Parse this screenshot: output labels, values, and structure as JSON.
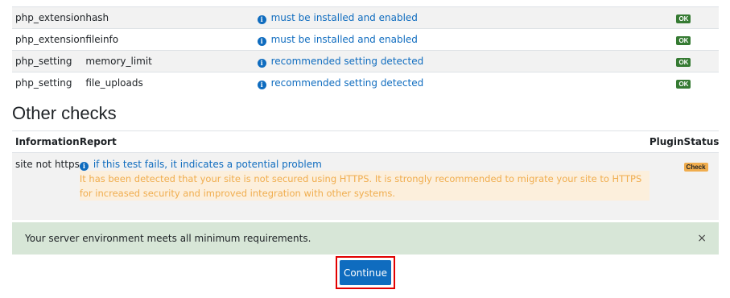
{
  "env_rows": [
    {
      "type": "php_extension",
      "name": "hash",
      "report": "must be installed and enabled",
      "status": "OK"
    },
    {
      "type": "php_extension",
      "name": "fileinfo",
      "report": "must be installed and enabled",
      "status": "OK"
    },
    {
      "type": "php_setting",
      "name": "memory_limit",
      "report": "recommended setting detected",
      "status": "OK"
    },
    {
      "type": "php_setting",
      "name": "file_uploads",
      "report": "recommended setting detected",
      "status": "OK"
    }
  ],
  "other_checks": {
    "heading": "Other checks",
    "columns": {
      "information": "Information",
      "report": "Report",
      "plugin": "Plugin",
      "status": "Status"
    },
    "rows": [
      {
        "information": "site not https",
        "report_link": "if this test fails, it indicates a potential problem",
        "report_detail": "It has been detected that your site is not secured using HTTPS. It is strongly recommended to migrate your site to HTTPS for increased security and improved integration with other systems.",
        "plugin": "",
        "status": "Check"
      }
    ]
  },
  "alert": {
    "message": "Your server environment meets all minimum requirements.",
    "close": "×"
  },
  "continue_label": "Continue",
  "icons": {
    "info": "info-icon",
    "close": "close-icon"
  },
  "colors": {
    "accent": "#0f6cbf",
    "ok": "#357a32",
    "warning": "#f0ad4e",
    "alert_bg": "#d7e6d7",
    "highlight": "#e20000"
  }
}
